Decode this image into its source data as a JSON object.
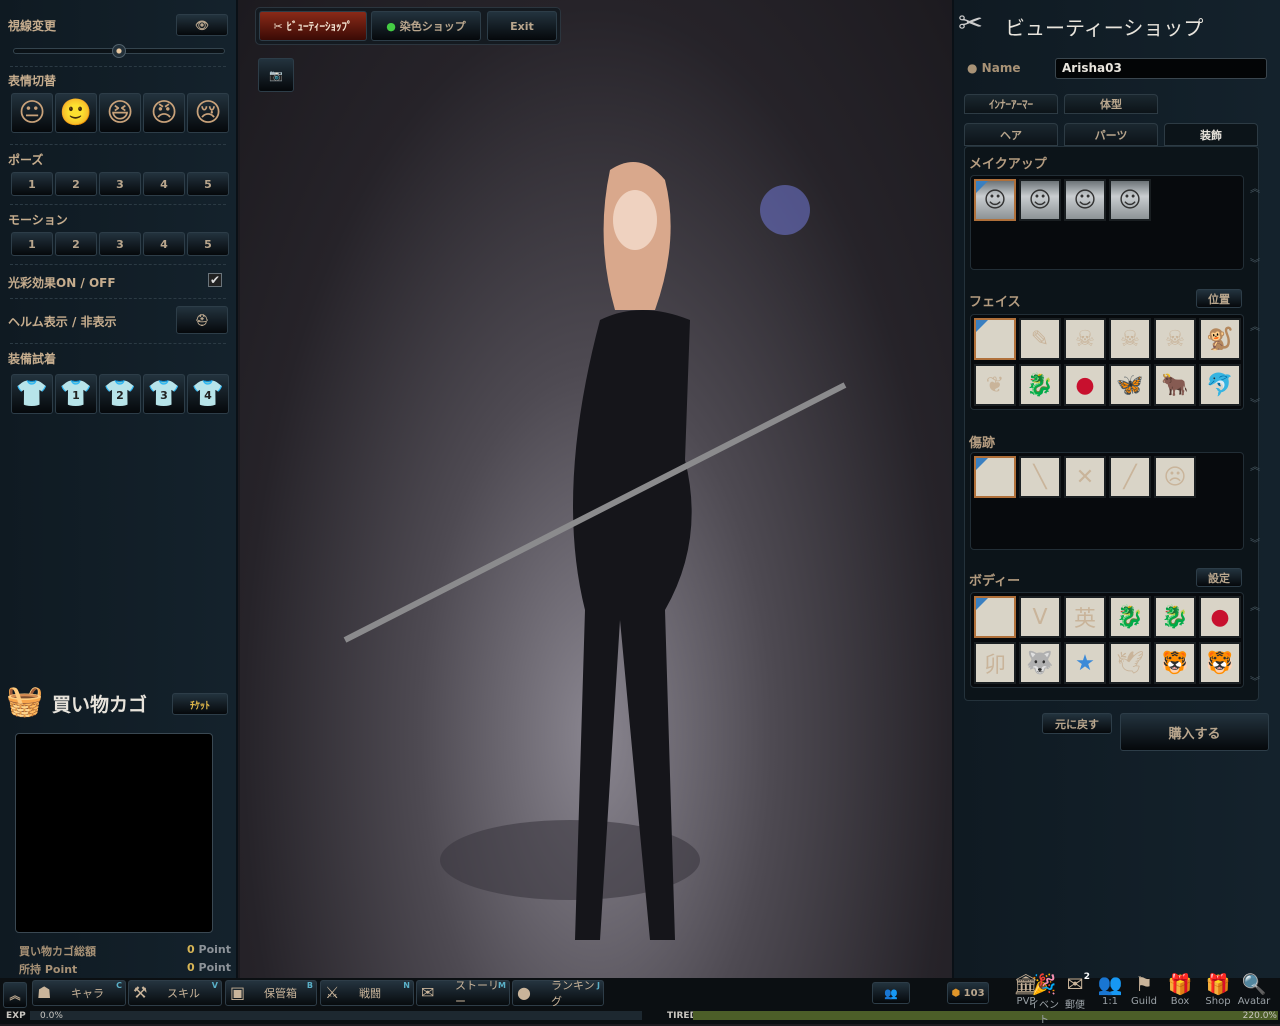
{
  "left": {
    "gaze_label": "視線変更",
    "gaze_slider": 0.5,
    "expression_label": "表情切替",
    "expressions": [
      "neutral-face-icon",
      "smile-face-icon",
      "laugh-face-icon",
      "angry-face-icon",
      "cry-face-icon"
    ],
    "pose_label": "ポーズ",
    "poses": [
      "1",
      "2",
      "3",
      "4",
      "5"
    ],
    "motion_label": "モーション",
    "motions": [
      "1",
      "2",
      "3",
      "4",
      "5"
    ],
    "lighting_label": "光彩効果ON / OFF",
    "lighting_checked": true,
    "helm_label": "ヘルム表示 / 非表示",
    "equip_label": "装備試着",
    "equip": [
      "",
      "1",
      "2",
      "3",
      "4"
    ],
    "cart_title": "買い物カゴ",
    "ticket_label": "ﾁｹｯﾄ",
    "cart_total_label": "買い物カゴ総額",
    "cart_total_value": "0",
    "owned_label": "所持 Point",
    "owned_value": "0",
    "point_unit": "Point"
  },
  "topbar": {
    "beauty_shop": "ﾋﾞｭｰﾃｨｰｼｮｯﾌﾟ",
    "dye_shop": "染色ショップ",
    "exit": "Exit"
  },
  "right": {
    "title": "ビューティーショップ",
    "name_label": "Name",
    "name_value": "Arisha03",
    "tabs_row1": [
      "ｲﾝﾅｰｱｰﾏｰ",
      "体型"
    ],
    "tabs_row2": [
      "ヘア",
      "パーツ",
      "装飾"
    ],
    "active_tab": "装飾",
    "makeup_label": "メイクアップ",
    "makeup": [
      "face",
      "face",
      "face",
      "face"
    ],
    "face_label": "フェイス",
    "position_button": "位置",
    "face_items": [
      "",
      "✎",
      "☠",
      "☠",
      "☠",
      "🐒",
      "❦",
      "🐉",
      "●",
      "🦋",
      "🐂",
      "🐬"
    ],
    "scar_label": "傷跡",
    "scar_items": [
      "",
      "╲",
      "✕",
      "╱",
      "☹"
    ],
    "body_label": "ボディー",
    "settings_button": "設定",
    "body_items": [
      "",
      "ᐯ",
      "英",
      "🐉",
      "🐉",
      "●",
      "卯",
      "🐺",
      "★",
      "🕊",
      "🐯",
      "🐯"
    ],
    "revert_button": "元に戻す",
    "buy_button": "購入する"
  },
  "bottom": {
    "menu": [
      {
        "label": "キャラ",
        "key": "C",
        "icon": "☗"
      },
      {
        "label": "スキル",
        "key": "V",
        "icon": "⚒"
      },
      {
        "label": "保管箱",
        "key": "B",
        "icon": "▣"
      },
      {
        "label": "戦闘",
        "key": "N",
        "icon": "⚔"
      },
      {
        "label": "ストーリー",
        "key": "M",
        "icon": "✉"
      },
      {
        "label": "ランキング",
        "key": "J",
        "icon": "●"
      }
    ],
    "exp_label": "EXP",
    "exp_value": "0.0%",
    "exp_fraction": 0.0,
    "tired_label": "TIRED",
    "tired_value": "220.0%",
    "currency": "103",
    "icons": [
      {
        "label": "PVP",
        "icon": "🏛"
      },
      {
        "label": "イベント",
        "icon": "🎉"
      },
      {
        "label": "郵便",
        "icon": "✉",
        "badge": "2"
      },
      {
        "label": "1:1",
        "icon": "👥"
      },
      {
        "label": "Guild",
        "icon": "⚑"
      },
      {
        "label": "Box",
        "icon": "🎁"
      },
      {
        "label": "Shop",
        "icon": "🎁"
      },
      {
        "label": "Avatar",
        "icon": "🔍"
      }
    ]
  },
  "colors": {
    "accent": "#c6ad8e",
    "selected_border": "#b0703a",
    "active_tab_bg": "#6b1a10",
    "tired_bar": "#4c5e28"
  }
}
